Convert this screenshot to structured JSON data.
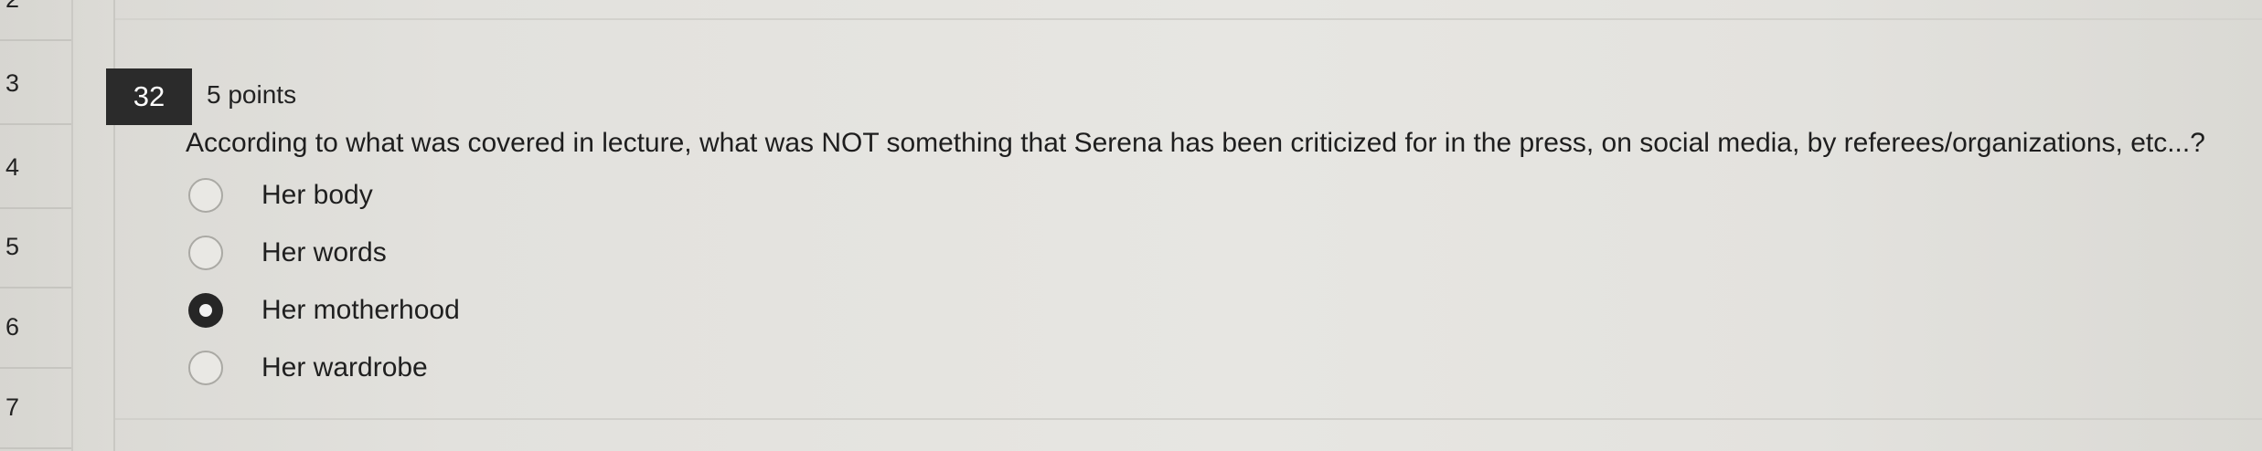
{
  "nav": {
    "items": [
      "2",
      "3",
      "4",
      "5",
      "6",
      "7"
    ]
  },
  "question": {
    "number": "32",
    "points": "5 points",
    "prompt": "According to what was covered in lecture, what was NOT something that Serena has been criticized for in the press, on social media, by referees/organizations, etc...?",
    "options": [
      {
        "label": "Her body",
        "selected": false
      },
      {
        "label": "Her words",
        "selected": false
      },
      {
        "label": "Her motherhood",
        "selected": true
      },
      {
        "label": "Her wardrobe",
        "selected": false
      }
    ]
  }
}
